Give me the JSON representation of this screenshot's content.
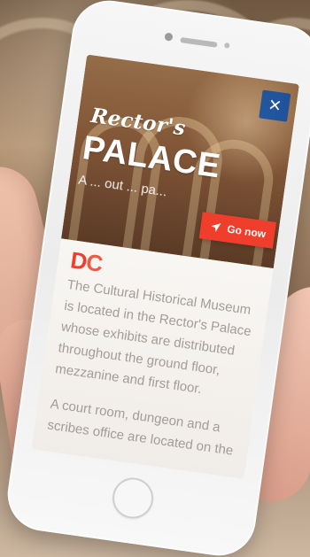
{
  "screen": {
    "script_title": "Rector's",
    "main_title": "PALACE",
    "hero_text": "A  ...\nout ...\npa...",
    "go_button": "Go now",
    "logo_left": "D",
    "logo_right": "C",
    "paragraphs": [
      "The Cultural Historical Museum is located in the Rector's Palace whose exhibits are distributed throughout the ground floor, mezzanine and first floor.",
      "A court room, dungeon and a scribes office are located on the"
    ]
  },
  "icons": {
    "close": "close-icon",
    "navigation": "navigation-arrow-icon"
  },
  "colors": {
    "accent": "#ef3f2c",
    "close_button": "#004aad",
    "text": "#a49c95"
  }
}
